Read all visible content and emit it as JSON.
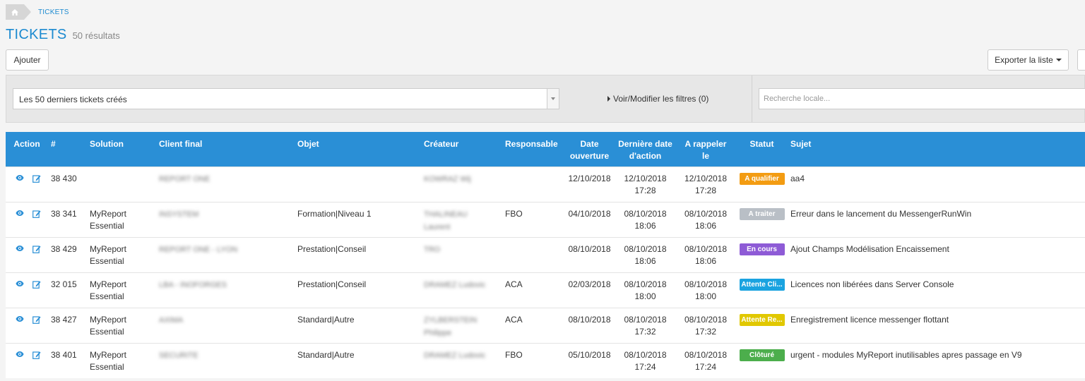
{
  "breadcrumb": {
    "home_icon": "home-icon",
    "current": "TICKETS"
  },
  "header": {
    "title": "TICKETS",
    "count": "50 résultats"
  },
  "toolbar": {
    "add_label": "Ajouter",
    "export_label": "Exporter la liste"
  },
  "filters": {
    "preset_value": "Les 50 derniers tickets créés",
    "toggle_label": "Voir/Modifier les filtres (0)",
    "search_placeholder": "Recherche locale..."
  },
  "table": {
    "headers": {
      "action": "Action",
      "num": "#",
      "solution": "Solution",
      "client": "Client final",
      "objet": "Objet",
      "createur": "Créateur",
      "responsable": "Responsable",
      "date_ouv_1": "Date",
      "date_ouv_2": "ouverture",
      "derniere_1": "Dernière date",
      "derniere_2": "d'action",
      "rappeler_1": "A rappeler",
      "rappeler_2": "le",
      "statut": "Statut",
      "sujet": "Sujet"
    },
    "rows": [
      {
        "num": "38 430",
        "sol1": "",
        "sol2": "",
        "client": "REPORT ONE",
        "objet": "",
        "cre1": "KOWRAZ Wij",
        "cre2": "",
        "resp": "",
        "date": "12/10/2018",
        "last1": "12/10/2018",
        "last2": "17:28",
        "rap1": "12/10/2018",
        "rap2": "17:28",
        "statut": "A qualifier",
        "statut_color": "#f39c12",
        "sujet": "aa4"
      },
      {
        "num": "38 341",
        "sol1": "MyReport",
        "sol2": "Essential",
        "client": "INSYSTEM",
        "objet": "Formation|Niveau 1",
        "cre1": "THALINEAU",
        "cre2": "Laurent",
        "resp": "FBO",
        "date": "04/10/2018",
        "last1": "08/10/2018",
        "last2": "18:06",
        "rap1": "08/10/2018",
        "rap2": "18:06",
        "statut": "A traiter",
        "statut_color": "#b9bfc6",
        "sujet": "Erreur dans le lancement du MessengerRunWin"
      },
      {
        "num": "38 429",
        "sol1": "MyReport",
        "sol2": "Essential",
        "client": "REPORT ONE - LYON",
        "objet": "Prestation|Conseil",
        "cre1": "TRO",
        "cre2": "",
        "resp": "",
        "date": "08/10/2018",
        "last1": "08/10/2018",
        "last2": "18:06",
        "rap1": "08/10/2018",
        "rap2": "18:06",
        "statut": "En cours",
        "statut_color": "#8e5bd6",
        "sujet": "Ajout Champs Modélisation Encaissement"
      },
      {
        "num": "32 015",
        "sol1": "MyReport",
        "sol2": "Essential",
        "client": "LBA - INOFORGES",
        "objet": "Prestation|Conseil",
        "cre1": "DRAMEZ Ludovic",
        "cre2": "",
        "resp": "ACA",
        "date": "02/03/2018",
        "last1": "08/10/2018",
        "last2": "18:00",
        "rap1": "08/10/2018",
        "rap2": "18:00",
        "statut": "Attente Cli...",
        "statut_color": "#1aa3e0",
        "sujet": "Licences non libérées dans Server Console"
      },
      {
        "num": "38 427",
        "sol1": "MyReport",
        "sol2": "Essential",
        "client": "AXIMA",
        "objet": "Standard|Autre",
        "cre1": "ZYLBERSTEIN",
        "cre2": "Philippe",
        "resp": "ACA",
        "date": "08/10/2018",
        "last1": "08/10/2018",
        "last2": "17:32",
        "rap1": "08/10/2018",
        "rap2": "17:32",
        "statut": "Attente Re...",
        "statut_color": "#e1c800",
        "sujet": "Enregistrement licence messenger flottant"
      },
      {
        "num": "38 401",
        "sol1": "MyReport",
        "sol2": "Essential",
        "client": "SECURITE",
        "objet": "Standard|Autre",
        "cre1": "DRAMEZ Ludovic",
        "cre2": "",
        "resp": "FBO",
        "date": "05/10/2018",
        "last1": "08/10/2018",
        "last2": "17:24",
        "rap1": "08/10/2018",
        "rap2": "17:24",
        "statut": "Clôturé",
        "statut_color": "#4cae4c",
        "sujet": "urgent - modules MyReport inutilisables apres passage en V9"
      }
    ]
  },
  "colors": {
    "accent": "#1c8ad0",
    "header_bg": "#2a8fd6",
    "icon": "#2a8fd6"
  },
  "icons": {
    "view": "eye-icon",
    "edit": "edit-icon"
  }
}
